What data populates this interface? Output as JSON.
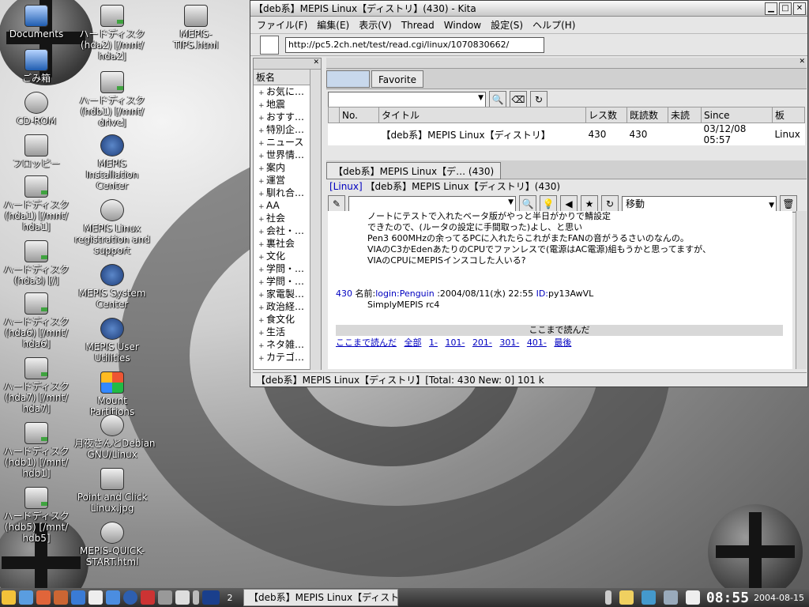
{
  "desktop_icons": [
    {
      "label": "Documents"
    },
    {
      "label": "ハードディスク\n(hda2) [/mnt/\nhda2]"
    },
    {
      "label": "MEPIS-TIPS.html"
    },
    {
      "label": "ごみ箱"
    },
    {
      "label": "ハードディスク\n(hdb1) [/mnt/\ndrive]"
    },
    {
      "label": "CD-ROM"
    },
    {
      "label": "MEPIS\nInstallation\nCenter"
    },
    {
      "label": "フロッピー"
    },
    {
      "label": "ハードディスク\n(hda1) [/mnt/\nhda1]"
    },
    {
      "label": "MEPIS Linux\nregistration and\nsupport"
    },
    {
      "label": "ハードディスク\n(hda3) [/]"
    },
    {
      "label": "MEPIS System\nCenter"
    },
    {
      "label": "ハードディスク\n(hda6) [/mnt/\nhda6]"
    },
    {
      "label": "MEPIS User\nUtilities"
    },
    {
      "label": "ハードディスク\n(hda7) [/mnt/\nhda7]"
    },
    {
      "label": "Mount Partitions"
    },
    {
      "label": "ハードディスク\n(hdb1) [/mnt/\nhdb1]"
    },
    {
      "label": "月夜さんとDebian\nGNU/Linux"
    },
    {
      "label": "Point and Click\nLinux.jpg"
    },
    {
      "label": "ハードディスク\n(hdb5) [/mnt/\nhdb5]"
    },
    {
      "label": "MEPIS-QUICK-\nSTART.html"
    }
  ],
  "window": {
    "title": "【deb系】MEPIS Linux【ディストリ】(430) - Kita",
    "menu": [
      "ファイル(F)",
      "編集(E)",
      "表示(V)",
      "Thread",
      "Window",
      "設定(S)",
      "ヘルプ(H)"
    ],
    "url": "http://pc5.2ch.net/test/read.cgi/linux/1070830662/",
    "board_header": "板名",
    "boards": [
      "お気に…",
      "地震",
      "おすす…",
      "特別企…",
      "ニュース",
      "世界情…",
      "案内",
      "運営",
      "馴れ合…",
      "AA",
      "社会",
      "会社・…",
      "裏社会",
      "文化",
      "学問・…",
      "学問・…",
      "家電製…",
      "政治経…",
      "食文化",
      "生活",
      "ネタ雑…",
      "カテゴ…"
    ],
    "tab_favorite": "Favorite",
    "columns": [
      "No.",
      "タイトル",
      "レス数",
      "既読数",
      "未読",
      "Since",
      "板"
    ],
    "thread_row": {
      "title": "【deb系】MEPIS Linux【ディストリ】",
      "res": "430",
      "read": "430",
      "unread": "",
      "since": "03/12/08 05:57",
      "board": "Linux"
    },
    "thread_tab": "【deb系】MEPIS Linux【デ… (430)",
    "board_link": "[Linux]",
    "thread_title": "【deb系】MEPIS Linux【ディストリ】(430)",
    "move_label": "移動",
    "body_lines": [
      "ノートにテストで入れたベータ版がやっと半日がかりで鯖設定",
      "できたので、(ルータの設定に手間取った)よし、と思い",
      "Pen3  600MHzの余ってるPCに入れたらこれがまたFANの音がうるさいのなんの。",
      "VIAのC3かEdenあたりのCPUでファンレスで(電源はAC電源)組もうかと思ってますが、",
      "VIAのCPUにMEPISインスコした人いる?"
    ],
    "post": {
      "num": "430",
      "name_label": "名前:",
      "name": "login:Penguin",
      "date": ":2004/08/11(水) 22:55",
      "id_label": "ID:",
      "id": "py13AwVL",
      "body": "SimplyMEPIS rc4"
    },
    "read_marker": "ここまで読んだ",
    "nav_links": [
      "ここまで読んだ",
      "全部",
      "1-",
      "101-",
      "201-",
      "301-",
      "401-",
      "最後"
    ],
    "status": "【deb系】MEPIS Linux【ディストリ】[Total: 430 New: 0] 101 k"
  },
  "taskbar": {
    "desktop_num": "2",
    "task": "【deb系】MEPIS Linux【ディスト",
    "time": "08:55",
    "date": "2004-08-15"
  }
}
